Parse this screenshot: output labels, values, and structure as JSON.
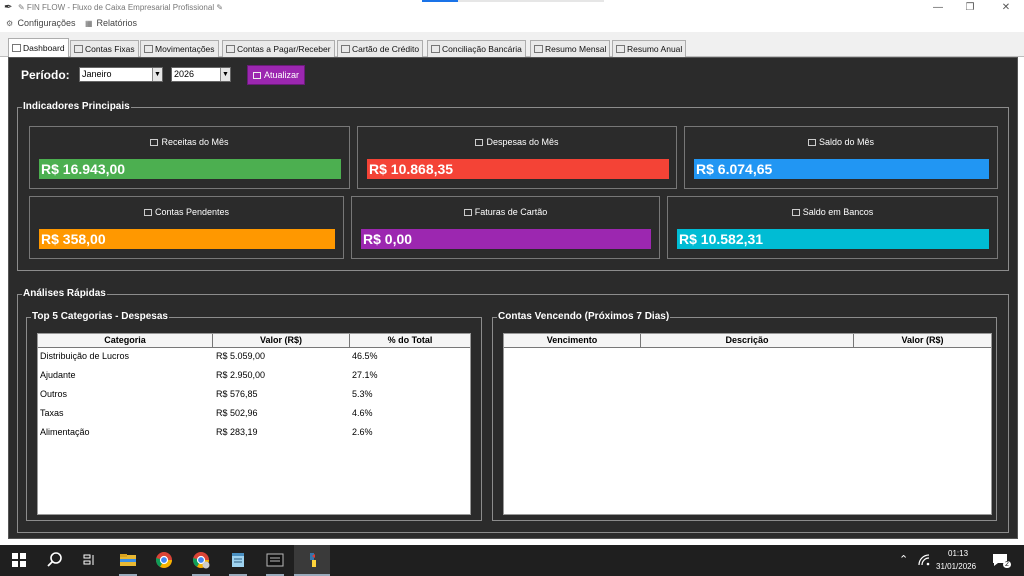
{
  "window": {
    "title": "✎ FIN FLOW - Fluxo de Caixa Empresarial Profissional ✎",
    "minimize_glyph": "—",
    "maximize_glyph": "❐",
    "close_glyph": "✕"
  },
  "menu": {
    "items": [
      {
        "label": "Configurações",
        "icon": "gear-icon"
      },
      {
        "label": "Relatórios",
        "icon": "report-icon"
      }
    ]
  },
  "tabs": [
    {
      "label": "Dashboard",
      "active": true
    },
    {
      "label": "Contas Fixas"
    },
    {
      "label": "Movimentações"
    },
    {
      "label": "Contas a Pagar/Receber"
    },
    {
      "label": "Cartão de Crédito"
    },
    {
      "label": "Conciliação Bancária"
    },
    {
      "label": "Resumo Mensal"
    },
    {
      "label": "Resumo Anual"
    }
  ],
  "period": {
    "label": "Período:",
    "month": "Janeiro",
    "year": "2026",
    "refresh_label": "Atualizar"
  },
  "indicators": {
    "title": "Indicadores Principais",
    "cards": [
      {
        "label": "Receitas do Mês",
        "value": "R$ 16.943,00",
        "color": "#4caf50"
      },
      {
        "label": "Despesas do Mês",
        "value": "R$ 10.868,35",
        "color": "#f44336"
      },
      {
        "label": "Saldo do Mês",
        "value": "R$ 6.074,65",
        "color": "#2196f3"
      },
      {
        "label": "Contas Pendentes",
        "value": "R$ 358,00",
        "color": "#ff9800"
      },
      {
        "label": "Faturas de Cartão",
        "value": "R$ 0,00",
        "color": "#9c27b0"
      },
      {
        "label": "Saldo em Bancos",
        "value": "R$ 10.582,31",
        "color": "#00bcd4"
      }
    ]
  },
  "analises": {
    "title": "Análises Rápidas",
    "top5": {
      "title": "Top 5 Categorias - Despesas",
      "columns": [
        "Categoria",
        "Valor (R$)",
        "% do Total"
      ],
      "rows": [
        [
          "Distribuição de Lucros",
          "R$ 5.059,00",
          "46.5%"
        ],
        [
          "Ajudante",
          "R$ 2.950,00",
          "27.1%"
        ],
        [
          "Outros",
          "R$ 576,85",
          "5.3%"
        ],
        [
          "Taxas",
          "R$ 502,96",
          "4.6%"
        ],
        [
          "Alimentação",
          "R$ 283,19",
          "2.6%"
        ]
      ]
    },
    "vencendo": {
      "title": "Contas Vencendo (Próximos 7 Dias)",
      "columns": [
        "Vencimento",
        "Descrição",
        "Valor (R$)"
      ],
      "rows": []
    }
  },
  "taskbar": {
    "time": "01:13",
    "date": "31/01/2026",
    "notification_count": "2"
  }
}
